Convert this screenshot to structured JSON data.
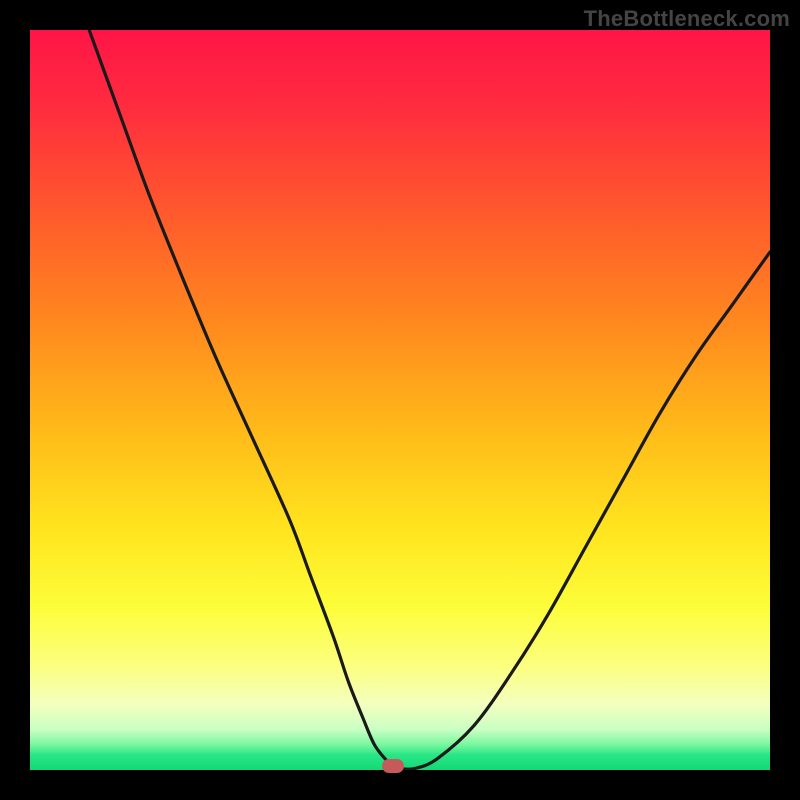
{
  "watermark": "TheBottleneck.com",
  "colors": {
    "frame": "#000000",
    "gradient_top": "#ff1547",
    "gradient_mid": "#ffe61f",
    "gradient_bottom": "#14d877",
    "curve": "#1a1a1a",
    "marker": "#c65a5a"
  },
  "chart_data": {
    "type": "line",
    "title": "",
    "xlabel": "",
    "ylabel": "",
    "xlim": [
      0,
      100
    ],
    "ylim": [
      0,
      100
    ],
    "grid": false,
    "series": [
      {
        "name": "bottleneck-curve",
        "x": [
          8,
          12,
          16,
          20,
          25,
          30,
          35,
          38,
          41,
          43,
          45,
          46.5,
          48,
          49,
          50,
          52,
          55,
          60,
          65,
          70,
          75,
          80,
          85,
          90,
          95,
          100
        ],
        "y": [
          100,
          89,
          78,
          68,
          56,
          45,
          34,
          26,
          18,
          12,
          7,
          3.5,
          1.5,
          0.6,
          0.2,
          0.2,
          1.5,
          6,
          13,
          21,
          30,
          39,
          48,
          56,
          63,
          70
        ]
      }
    ],
    "marker": {
      "x": 49,
      "y": 0.6
    },
    "annotations": [
      {
        "text": "TheBottleneck.com",
        "role": "watermark"
      }
    ]
  }
}
